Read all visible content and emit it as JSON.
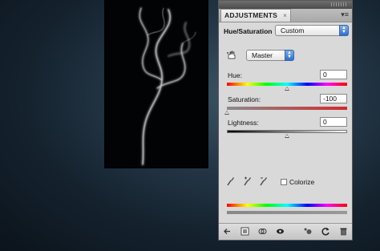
{
  "panel": {
    "tab_title": "ADJUSTMENTS",
    "tab_close": "×",
    "menu_glyph": "▾≡",
    "adjustment_name": "Hue/Saturation",
    "preset": {
      "selected": "Custom"
    },
    "channel": {
      "selected": "Master"
    },
    "hue": {
      "label": "Hue:",
      "value": "0",
      "percent": 50
    },
    "saturation": {
      "label": "Saturation:",
      "value": "-100",
      "percent": 0
    },
    "lightness": {
      "label": "Lightness:",
      "value": "0",
      "percent": 50
    },
    "colorize": {
      "label": "Colorize",
      "checked": false
    }
  },
  "colors": {
    "panel_bg": "#d9d9d9",
    "select_accent": "#2d6fd0",
    "photo_bg": "#020304"
  },
  "icons": {
    "hand_tool": "targeted-adjustment-hand-icon",
    "eyedropper": "eyedropper-icon",
    "eyedropper_plus": "eyedropper-plus-icon",
    "eyedropper_minus": "eyedropper-minus-icon",
    "return": "return-to-list-icon",
    "expand": "expand-view-icon",
    "clip": "clip-to-layer-icon",
    "visibility": "visibility-eye-icon",
    "previous_state": "view-previous-state-icon",
    "reset": "reset-icon",
    "delete": "delete-trash-icon"
  }
}
